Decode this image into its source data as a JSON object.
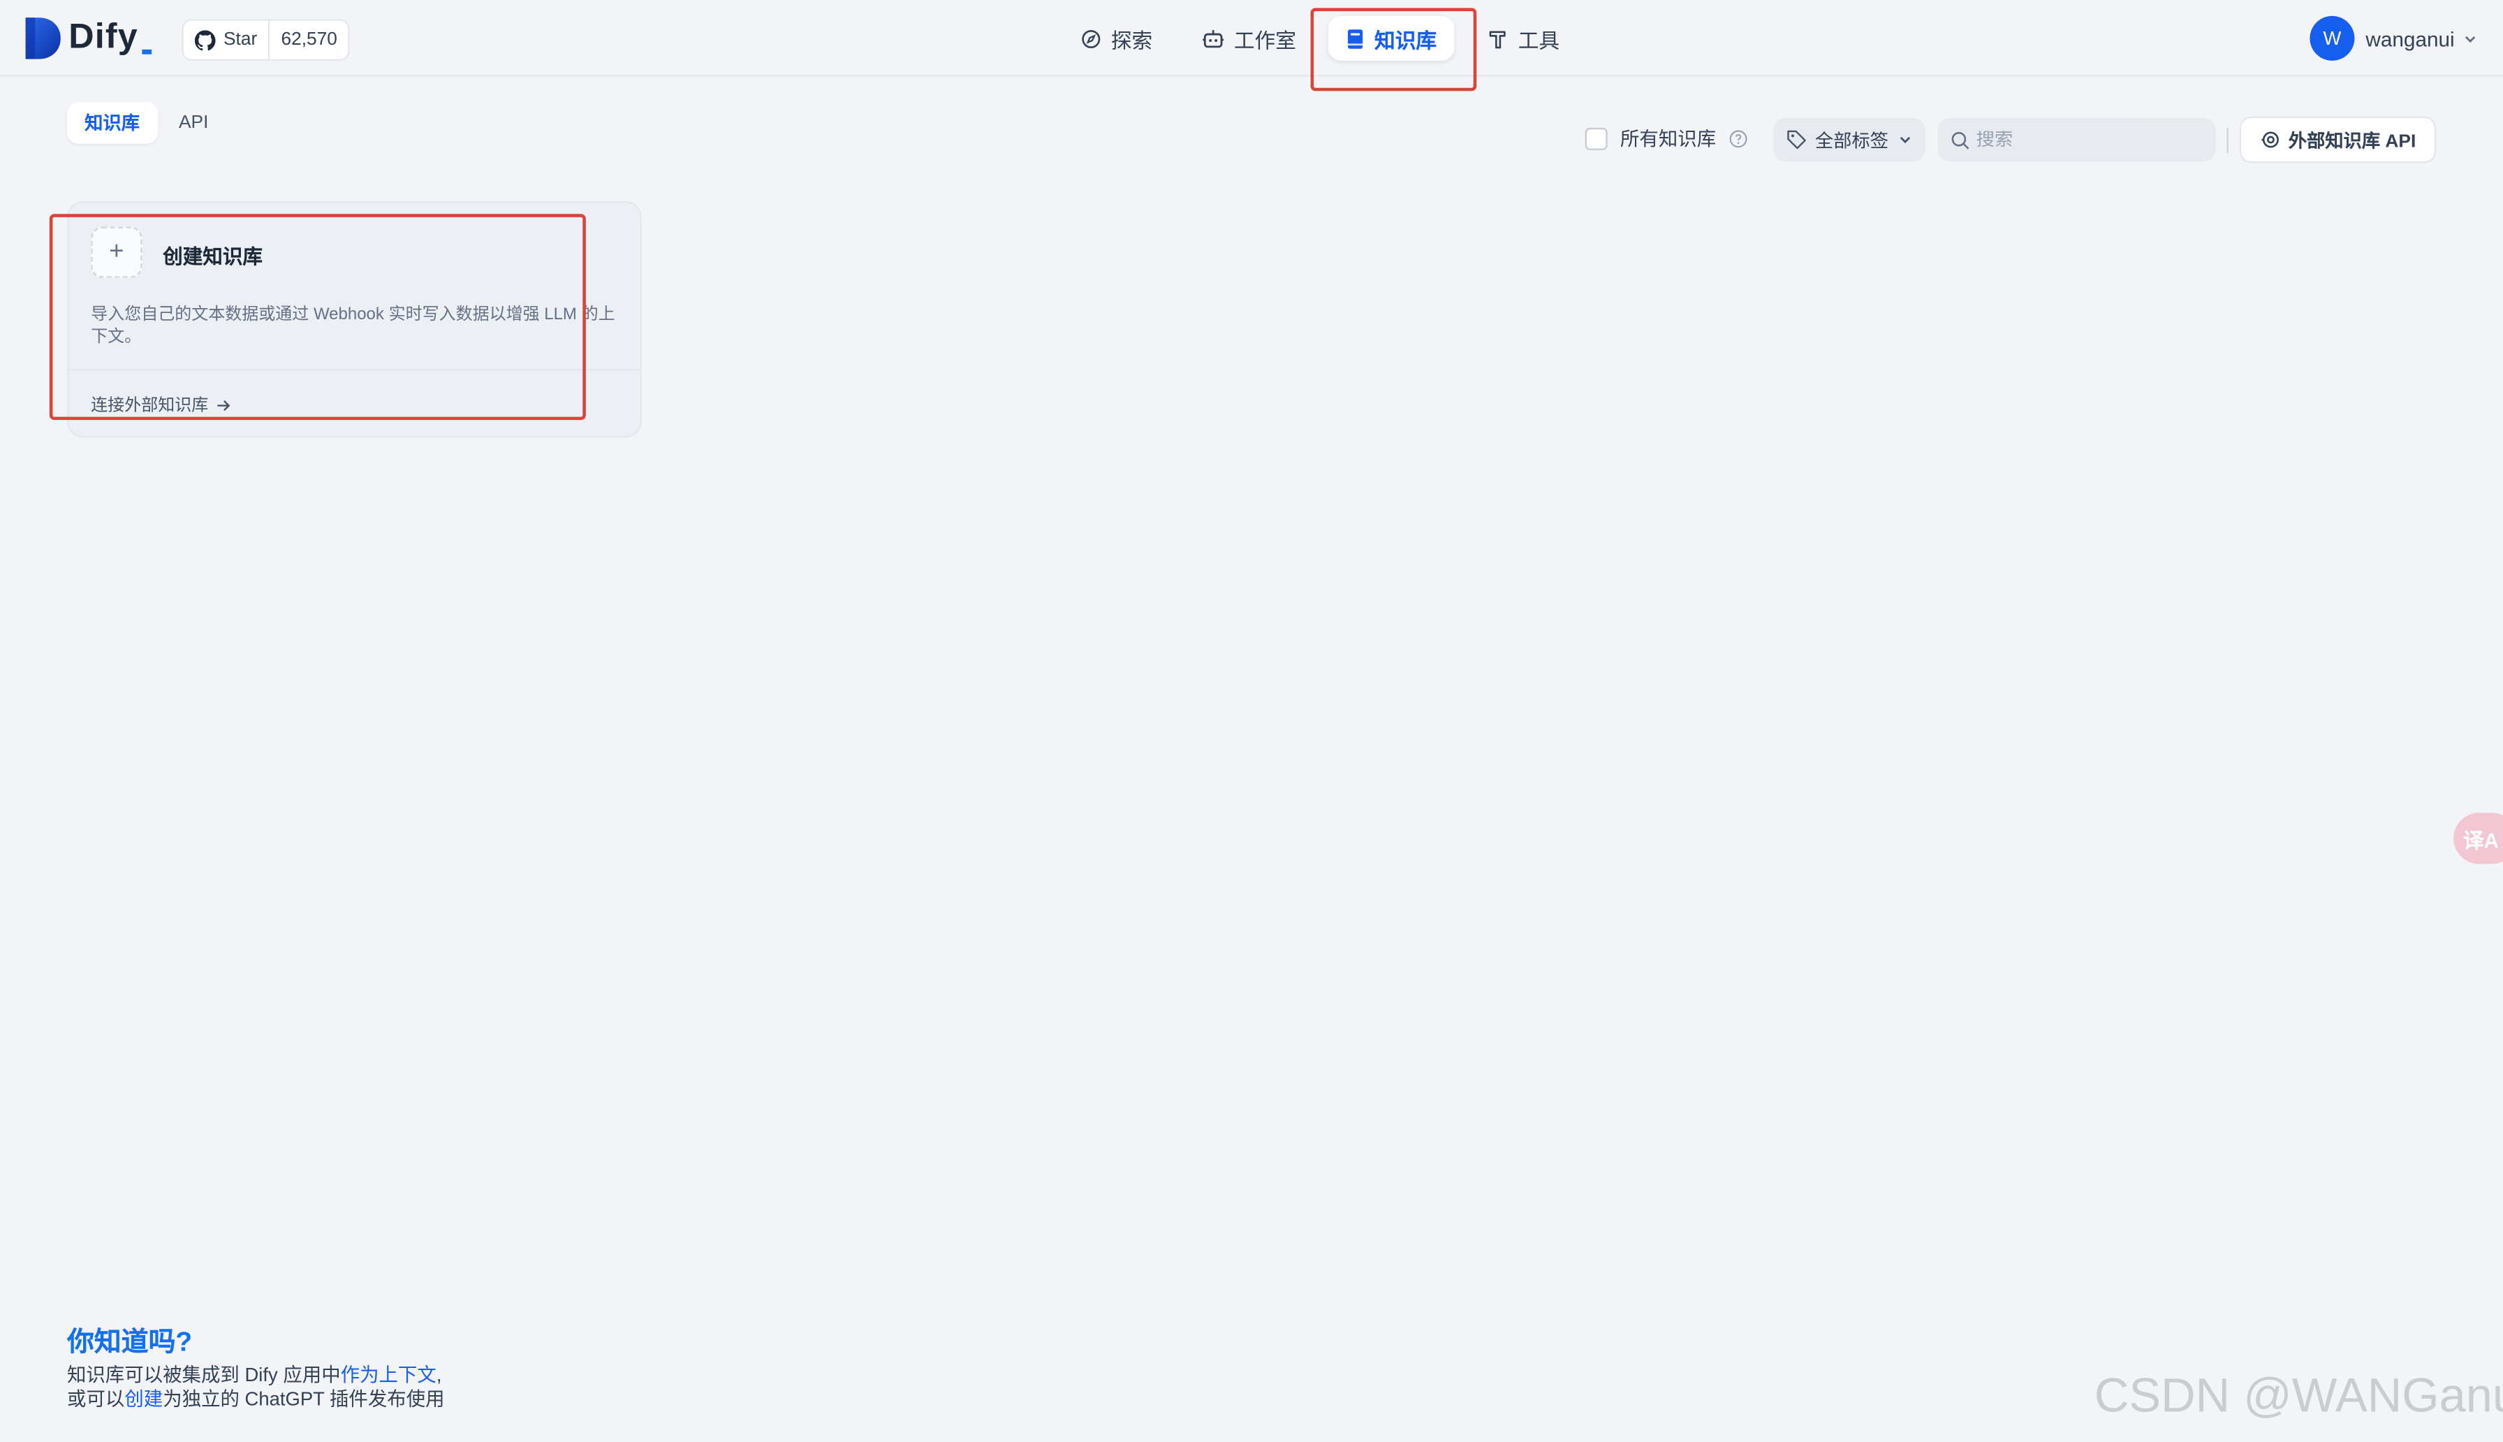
{
  "header": {
    "brand": "Dify",
    "github": {
      "star_label": "Star",
      "star_count": "62,570"
    },
    "nav": [
      {
        "label": "探索",
        "icon": "compass-icon"
      },
      {
        "label": "工作室",
        "icon": "robot-icon"
      },
      {
        "label": "知识库",
        "icon": "book-icon",
        "active": true
      },
      {
        "label": "工具",
        "icon": "hammer-icon"
      }
    ],
    "user": {
      "initial": "W",
      "name": "wanganui"
    }
  },
  "subheader": {
    "tabs": [
      {
        "label": "知识库",
        "active": true
      },
      {
        "label": "API",
        "active": false
      }
    ],
    "all_kb_label": "所有知识库",
    "tags_label": "全部标签",
    "search_placeholder": "搜索",
    "external_api_label": "外部知识库 API"
  },
  "card": {
    "title": "创建知识库",
    "description": "导入您自己的文本数据或通过 Webhook 实时写入数据以增强 LLM 的上下文。",
    "link_label": "连接外部知识库"
  },
  "tips": {
    "title": "你知道吗?",
    "line1_prefix": "知识库可以被集成到 Dify 应用中",
    "line1_link": "作为上下文",
    "line1_suffix": ",",
    "line2_prefix": "或可以",
    "line2_link": "创建",
    "line2_suffix": "为独立的 ChatGPT 插件发布使用"
  },
  "translate_fab_label": "译A",
  "watermark": "CSDN @WANGanui",
  "colors": {
    "accent": "#155eef",
    "background": "#f2f4f7",
    "highlight_box": "#d9453a"
  }
}
